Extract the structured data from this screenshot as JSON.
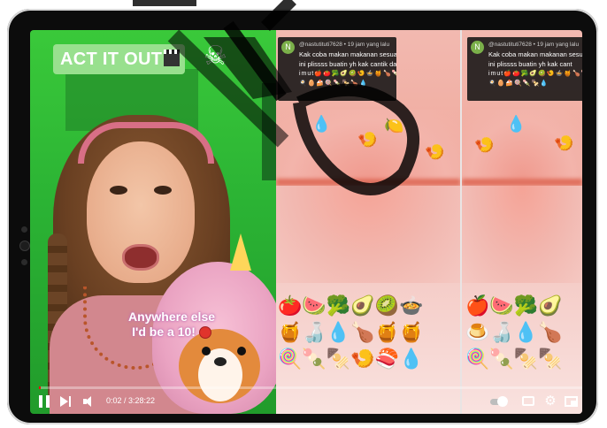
{
  "overlay": {
    "badge_text": "ACT IT OUT",
    "badge_icon": "clapperboard-icon",
    "skull_icon": "☠",
    "caption_line1": "Anywhere else",
    "caption_line2": "I'd be a 10!"
  },
  "comment_mid": {
    "avatar_letter": "N",
    "meta": "@nastutituti7628 • 19 jam yang lalu",
    "line1": "Kak coba makan makanan sesuai",
    "line2": "ini plissss buatin yh kak cantik dan",
    "line3": "imut🍎🍅🥦🥑🥝🍤🍲🍯🍗🍡🍭💧🥚",
    "line4": "🍳🥚🍰🍭🍡🍢🍗💧"
  },
  "comment_right": {
    "avatar_letter": "N",
    "meta": "@nastutituti7628 • 19 jam yang lalu",
    "line1": "Kak coba makan makanan sesuai",
    "line2": "ini plissss buatin yh kak cant",
    "line3": "imut🍎🍅🥦🥑🥝🍤🍲🍯🍗🍡",
    "line4": "🍳🥚🍰🍭🍡🍢💧"
  },
  "emoji_mid": {
    "row1": "🍅🍉🥦🥑🥝🍲",
    "row2": "🍯🍶💧🍗🍯🍯",
    "row3": "🍭🍡🍢🍤🍣💧"
  },
  "emoji_right": {
    "row1": "🍎🍉🥦🥑",
    "row2": "🍮🍶💧🍗",
    "row3": "🍭🍡🍢🍢"
  },
  "player": {
    "time_current": "0:02",
    "time_total": "3:28:22",
    "time_display": "0:02 / 3:28:22",
    "progress_fraction": 0.001,
    "progress_color": "#ff0000"
  },
  "colors": {
    "badge_bg": "#98e08e",
    "green_screen": "#2bb334",
    "lip_red": "#e0705e"
  }
}
